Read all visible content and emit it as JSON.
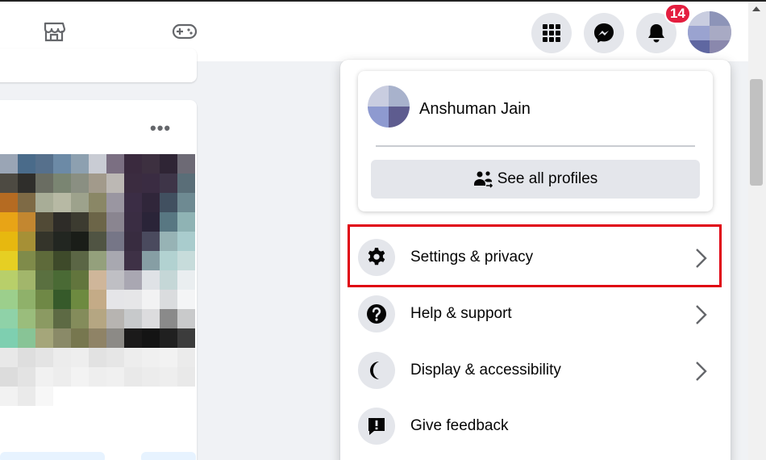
{
  "topbar": {
    "nav_icons": [
      "marketplace-icon",
      "gaming-icon"
    ],
    "buttons": [
      "menu-grid-icon",
      "messenger-icon",
      "notifications-icon"
    ],
    "notification_count": "14"
  },
  "account_menu": {
    "profile_name": "Anshuman Jain",
    "see_all_profiles": "See all profiles",
    "items": [
      {
        "label": "Settings & privacy",
        "icon": "gear-icon",
        "has_chevron": true,
        "highlighted": true
      },
      {
        "label": "Help & support",
        "icon": "question-icon",
        "has_chevron": true
      },
      {
        "label": "Display & accessibility",
        "icon": "moon-icon",
        "has_chevron": true
      },
      {
        "label": "Give feedback",
        "icon": "feedback-icon",
        "has_chevron": false
      }
    ]
  },
  "colors": {
    "badge": "#e41e3f",
    "highlight_border": "#e00010",
    "button_bg": "#e4e6eb",
    "page_bg": "#f0f2f5"
  }
}
